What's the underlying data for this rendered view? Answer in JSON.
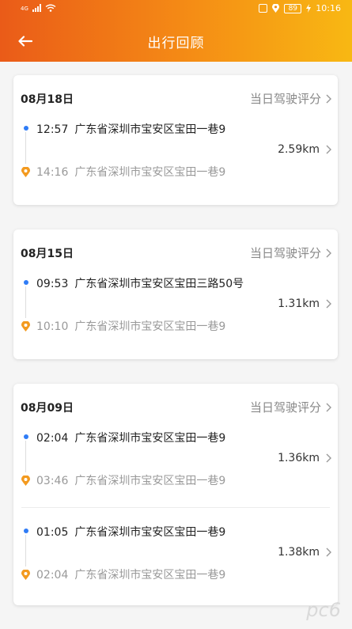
{
  "status_bar": {
    "network": "4G",
    "time": "10:16",
    "battery": "89"
  },
  "nav": {
    "title": "出行回顾"
  },
  "days": [
    {
      "date": "08月18日",
      "score_label": "当日驾驶评分",
      "trips": [
        {
          "start_time": "12:57",
          "start_addr": "广东省深圳市宝安区宝田一巷9",
          "distance": "2.59km",
          "end_time": "14:16",
          "end_addr": "广东省深圳市宝安区宝田一巷9"
        }
      ]
    },
    {
      "date": "08月15日",
      "score_label": "当日驾驶评分",
      "trips": [
        {
          "start_time": "09:53",
          "start_addr": "广东省深圳市宝安区宝田三路50号",
          "distance": "1.31km",
          "end_time": "10:10",
          "end_addr": "广东省深圳市宝安区宝田一巷9"
        }
      ]
    },
    {
      "date": "08月09日",
      "score_label": "当日驾驶评分",
      "trips": [
        {
          "start_time": "02:04",
          "start_addr": "广东省深圳市宝安区宝田一巷9",
          "distance": "1.36km",
          "end_time": "03:46",
          "end_addr": "广东省深圳市宝安区宝田一巷9"
        },
        {
          "start_time": "01:05",
          "start_addr": "广东省深圳市宝安区宝田一巷9",
          "distance": "1.38km",
          "end_time": "02:04",
          "end_addr": "广东省深圳市宝安区宝田一巷9"
        }
      ]
    }
  ],
  "watermark": "pc6",
  "colors": {
    "header_start": "#ea5b18",
    "header_end": "#f8b813",
    "start_dot": "#2f7cf6",
    "end_pin": "#f39a1f"
  }
}
